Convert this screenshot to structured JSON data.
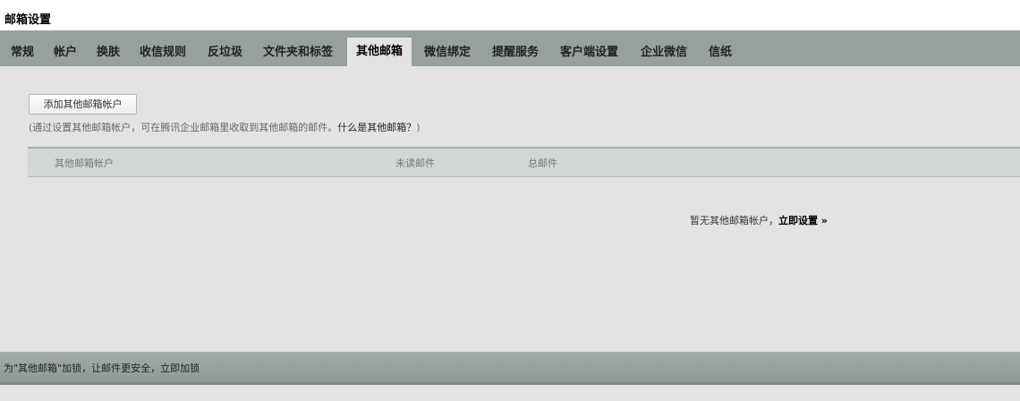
{
  "page_title": "邮箱设置",
  "tabs": [
    {
      "label": "常规"
    },
    {
      "label": "帐户"
    },
    {
      "label": "换肤"
    },
    {
      "label": "收信规则"
    },
    {
      "label": "反垃圾"
    },
    {
      "label": "文件夹和标签"
    },
    {
      "label": "其他邮箱",
      "active": true
    },
    {
      "label": "微信绑定"
    },
    {
      "label": "提醒服务"
    },
    {
      "label": "客户端设置"
    },
    {
      "label": "企业微信"
    },
    {
      "label": "信纸"
    }
  ],
  "add_button_label": "添加其他邮箱帐户",
  "description": {
    "prefix": "(通过设置其他邮箱帐户，可在腾讯企业邮箱里收取到其他邮箱的邮件。",
    "link": "什么是其他邮箱？",
    "suffix": ")"
  },
  "table": {
    "columns": [
      "其他邮箱帐户",
      "未读邮件",
      "总邮件"
    ]
  },
  "empty_state": {
    "text": "暂无其他邮箱帐户，",
    "link": "立即设置 »"
  },
  "footer": {
    "prefix": "为\"其他邮箱\"加锁，让邮件更安全，",
    "link": "立即加锁"
  },
  "colors": {
    "tabbar": "#97a19c",
    "content_bg": "#e2e4e3",
    "table_header": "#d2d6d4",
    "footer": "#97a19c"
  }
}
